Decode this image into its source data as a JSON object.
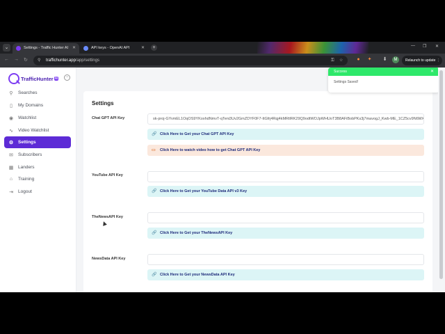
{
  "browser": {
    "tabs": [
      {
        "label": "Settings - Traffic Hunter AI",
        "active": true
      },
      {
        "label": "API keys - OpenAI API",
        "active": false
      }
    ],
    "address": {
      "host": "traffichunter.app",
      "path": "/app/settings"
    },
    "relaunch_label": "Relaunch to update",
    "avatar_letter": "M"
  },
  "sidebar": {
    "logo_text": "TrafficHunter",
    "logo_badge": "AI",
    "items": [
      {
        "label": "Searches",
        "icon": "search-icon"
      },
      {
        "label": "My Domains",
        "icon": "bookmark-icon"
      },
      {
        "label": "Watchlist",
        "icon": "eye-icon"
      },
      {
        "label": "Video Watchlist",
        "icon": "activity-icon"
      },
      {
        "label": "Settings",
        "icon": "gear-icon",
        "active": true
      },
      {
        "label": "Subscribers",
        "icon": "mail-icon"
      },
      {
        "label": "Landers",
        "icon": "grid-icon"
      },
      {
        "label": "Training",
        "icon": "graduation-cap-icon"
      },
      {
        "label": "Logout",
        "icon": "logout-icon"
      }
    ]
  },
  "main": {
    "title": "Settings",
    "rows": [
      {
        "label": "Chat GPT API Key",
        "value": "sk-proj-GYvmEL1OqOS9YKoxhdNmvT-qTeni3Uv2GmZDYF0F7-ItGfrj4Rqj4kMRtlRK29Q9odtWOJpWHUoT3B8AFiBobPKs3j7mavogJ_Kwb-ME_1CZ5cv9N6MXZIy",
        "links": [
          {
            "label": "Click Here to Get your Chat GPT API Key",
            "kind": "link"
          },
          {
            "label": "Click Here to watch video how to get Chat GPT API Key",
            "kind": "video"
          }
        ]
      },
      {
        "label": "YouTube API Key",
        "value": "",
        "links": [
          {
            "label": "Click Here to Get your YouTube Data API v3 Key",
            "kind": "link"
          }
        ]
      },
      {
        "label": "TheNewsAPI Key",
        "value": "",
        "links": [
          {
            "label": "Click Here to Get your TheNewsAPI Key",
            "kind": "link"
          }
        ]
      },
      {
        "label": "NewsData API Key",
        "value": "",
        "links": [
          {
            "label": "Click Here to Get your NewsData API Key",
            "kind": "link"
          }
        ]
      }
    ]
  },
  "toast": {
    "title": "Success",
    "message": "Settings Saved!"
  },
  "colors": {
    "accent": "#5d2bd6",
    "toast": "#2ee86a",
    "link_bg": "#dcf5f6",
    "video_bg": "#fbe8dd"
  }
}
